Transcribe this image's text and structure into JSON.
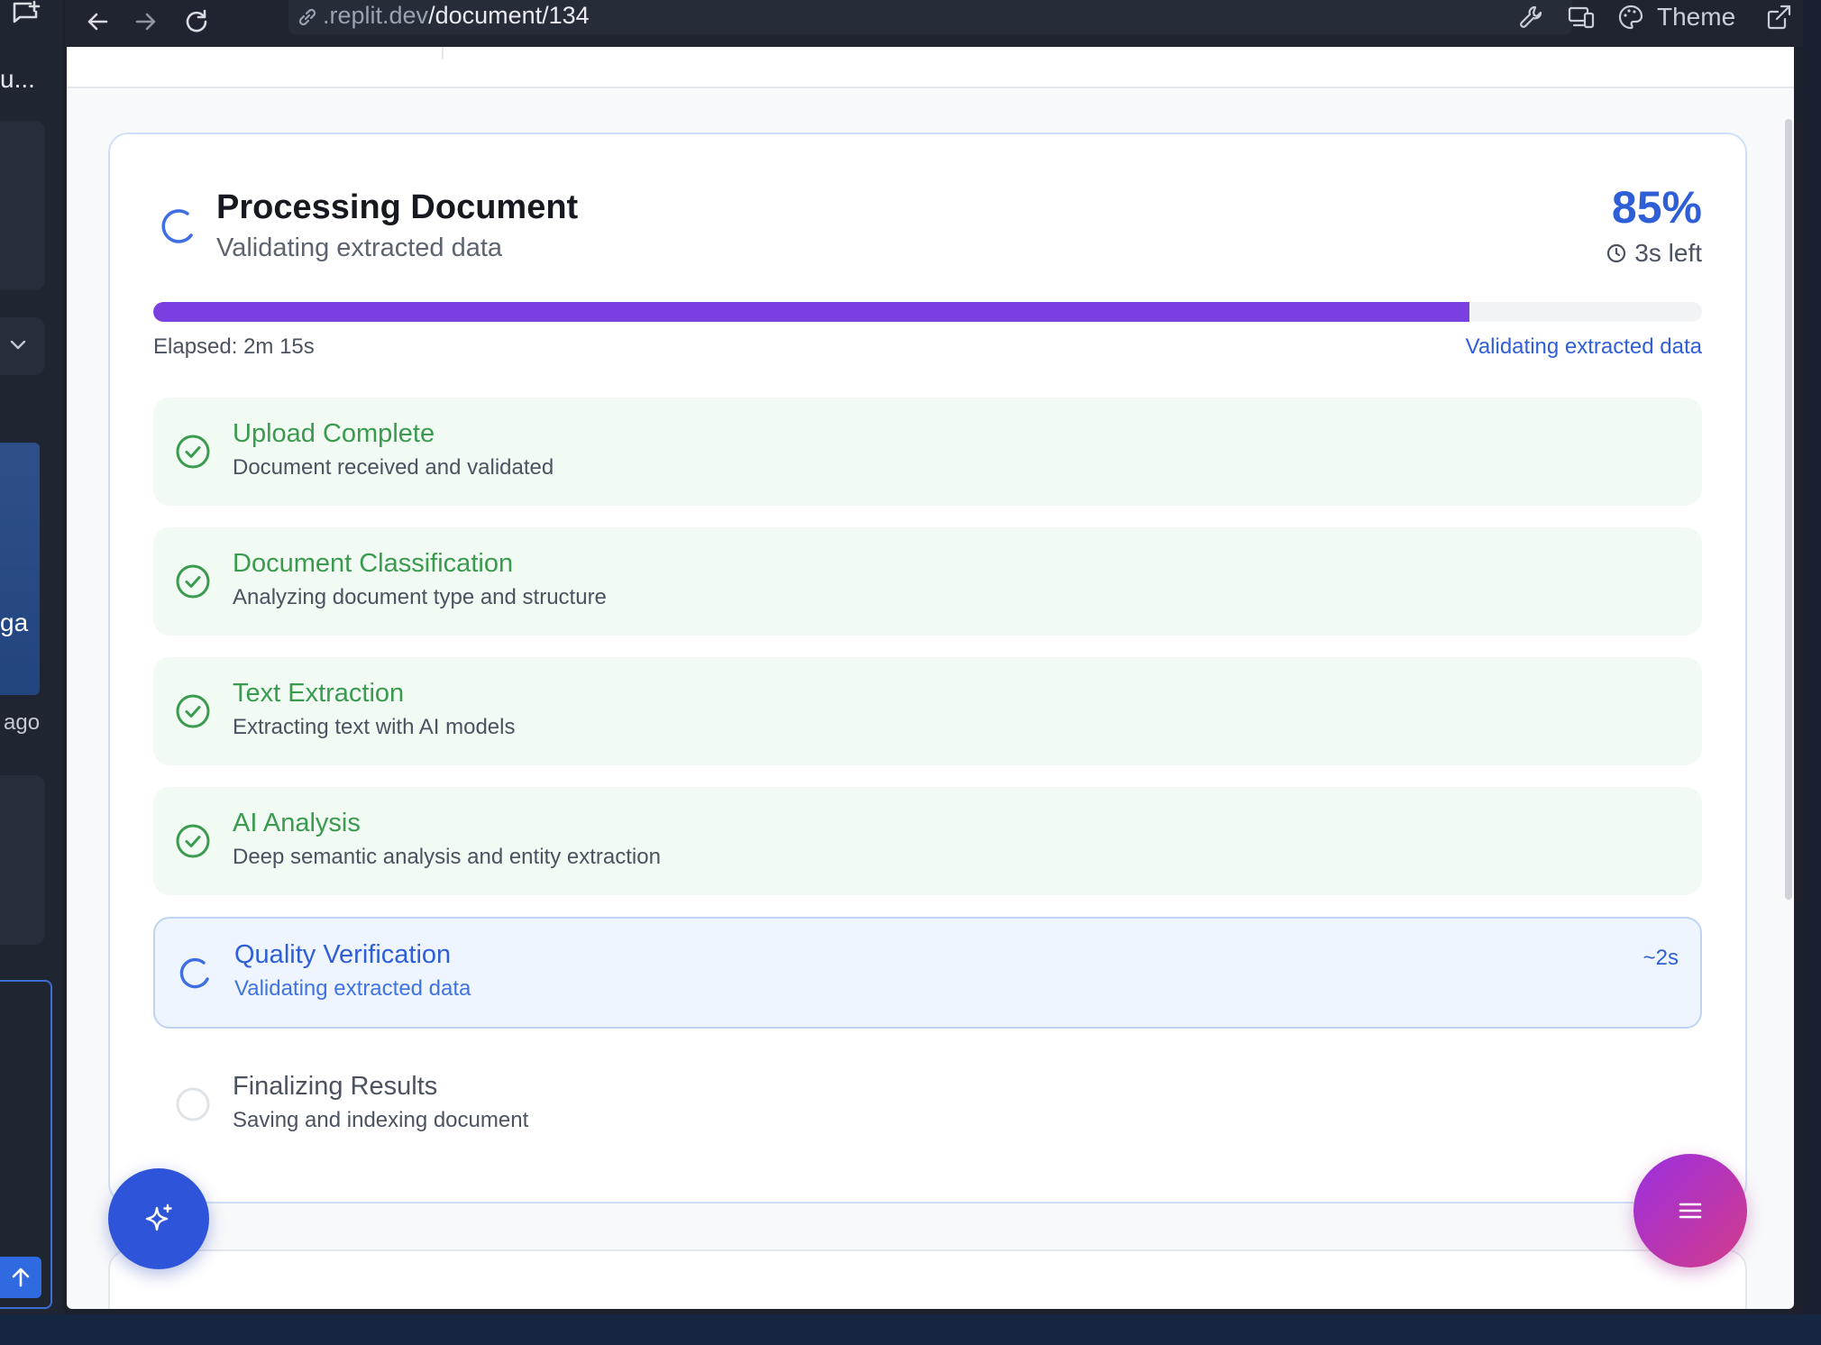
{
  "browser": {
    "url_prefix": ".replit.dev",
    "url_path": "/document/134",
    "theme_label": "Theme"
  },
  "sidebar": {
    "truncated_title": "u...",
    "blue_card_text": "ga",
    "time_ago": "ago"
  },
  "processing": {
    "title": "Processing Document",
    "subtitle": "Validating extracted data",
    "percent_label": "85%",
    "progress_fraction": 0.85,
    "time_left": "3s left",
    "elapsed": "Elapsed: 2m 15s",
    "current_phase": "Validating extracted data",
    "accent_color": "#2f5fd7",
    "progress_color": "#7a3fe0"
  },
  "steps": [
    {
      "title": "Upload Complete",
      "description": "Document received and validated",
      "status": "done"
    },
    {
      "title": "Document Classification",
      "description": "Analyzing document type and structure",
      "status": "done"
    },
    {
      "title": "Text Extraction",
      "description": "Extracting text with AI models",
      "status": "done"
    },
    {
      "title": "AI Analysis",
      "description": "Deep semantic analysis and entity extraction",
      "status": "done"
    },
    {
      "title": "Quality Verification",
      "description": "Validating extracted data",
      "status": "active",
      "eta": "~2s"
    },
    {
      "title": "Finalizing Results",
      "description": "Saving and indexing document",
      "status": "pending"
    }
  ],
  "icons": {
    "left_fab": "sparkle-icon",
    "right_fab": "menu-icon",
    "done": "check-circle-icon",
    "active": "spinner-icon",
    "pending": "empty-circle-icon"
  }
}
